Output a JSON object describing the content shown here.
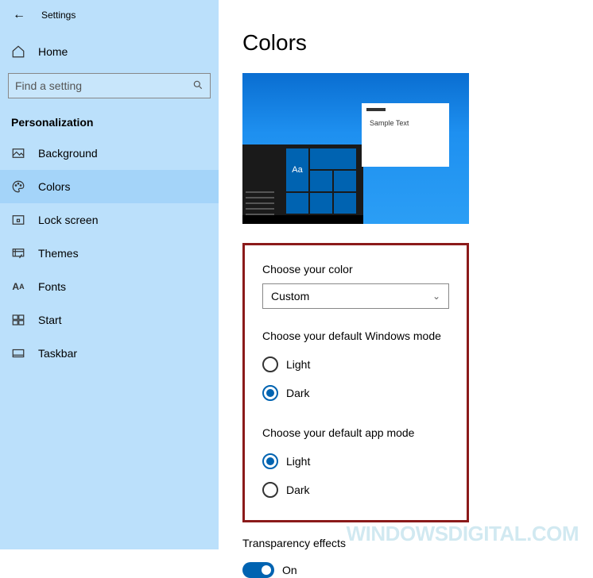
{
  "header": {
    "back_icon": "←",
    "title": "Settings"
  },
  "home": {
    "label": "Home"
  },
  "search": {
    "placeholder": "Find a setting"
  },
  "section": "Personalization",
  "nav": [
    {
      "label": "Background",
      "icon": "image-icon"
    },
    {
      "label": "Colors",
      "icon": "palette-icon",
      "active": true
    },
    {
      "label": "Lock screen",
      "icon": "lock-screen-icon"
    },
    {
      "label": "Themes",
      "icon": "paint-icon"
    },
    {
      "label": "Fonts",
      "icon": "font-icon"
    },
    {
      "label": "Start",
      "icon": "start-icon"
    },
    {
      "label": "Taskbar",
      "icon": "taskbar-icon"
    }
  ],
  "page": {
    "title": "Colors",
    "preview": {
      "sample": "Sample Text",
      "aa": "Aa"
    },
    "choose_color_label": "Choose your color",
    "choose_color_value": "Custom",
    "windows_mode": {
      "label": "Choose your default Windows mode",
      "options": [
        "Light",
        "Dark"
      ],
      "selected": "Dark"
    },
    "app_mode": {
      "label": "Choose your default app mode",
      "options": [
        "Light",
        "Dark"
      ],
      "selected": "Light"
    },
    "transparency": {
      "label": "Transparency effects",
      "value": "On"
    }
  },
  "watermark": "WINDOWSDIGITAL.COM"
}
